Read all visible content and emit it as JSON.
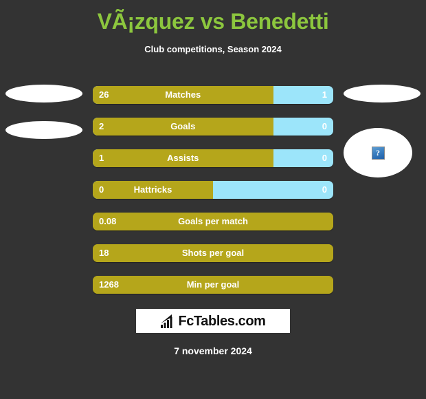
{
  "header": {
    "title": "VÃ¡zquez vs Benedetti",
    "subtitle": "Club competitions, Season 2024",
    "title_color": "#8cc63e"
  },
  "colors": {
    "background": "#333333",
    "home_bar": "#b5a61b",
    "away_bar": "#9ce5fa",
    "text": "#ffffff"
  },
  "media": {
    "left_photo_top": "player-photo-placeholder",
    "left_photo_bottom": "player-photo-placeholder",
    "right_photo_top": "player-photo-placeholder",
    "right_photo_bottom": "broken-image-placeholder",
    "broken_image_glyph": "?"
  },
  "chart_data": {
    "type": "bar",
    "title": "VÃ¡zquez vs Benedetti",
    "subtitle": "Club competitions, Season 2024",
    "orientation": "horizontal-diverging",
    "categories": [
      "Matches",
      "Goals",
      "Assists",
      "Hattricks",
      "Goals per match",
      "Shots per goal",
      "Min per goal"
    ],
    "series": [
      {
        "name": "VÃ¡zquez",
        "color": "#b5a61b",
        "values": [
          "26",
          "2",
          "1",
          "0",
          "0.08",
          "18",
          "1268"
        ]
      },
      {
        "name": "Benedetti",
        "color": "#9ce5fa",
        "values": [
          "1",
          "0",
          "0",
          "0",
          null,
          null,
          null
        ]
      }
    ],
    "legend": "none",
    "grid": false
  },
  "bars": [
    {
      "label": "Matches",
      "home": "26",
      "away": "1",
      "home_pct": 75,
      "split": true
    },
    {
      "label": "Goals",
      "home": "2",
      "away": "0",
      "home_pct": 75,
      "split": true
    },
    {
      "label": "Assists",
      "home": "1",
      "away": "0",
      "home_pct": 75,
      "split": true
    },
    {
      "label": "Hattricks",
      "home": "0",
      "away": "0",
      "home_pct": 50,
      "split": true
    },
    {
      "label": "Goals per match",
      "home": "0.08",
      "away": "",
      "home_pct": 100,
      "split": false
    },
    {
      "label": "Shots per goal",
      "home": "18",
      "away": "",
      "home_pct": 100,
      "split": false
    },
    {
      "label": "Min per goal",
      "home": "1268",
      "away": "",
      "home_pct": 100,
      "split": false
    }
  ],
  "footer": {
    "logo_text": "FcTables.com",
    "logo_icon": "bar-chart-growth-icon",
    "date": "7 november 2024"
  }
}
